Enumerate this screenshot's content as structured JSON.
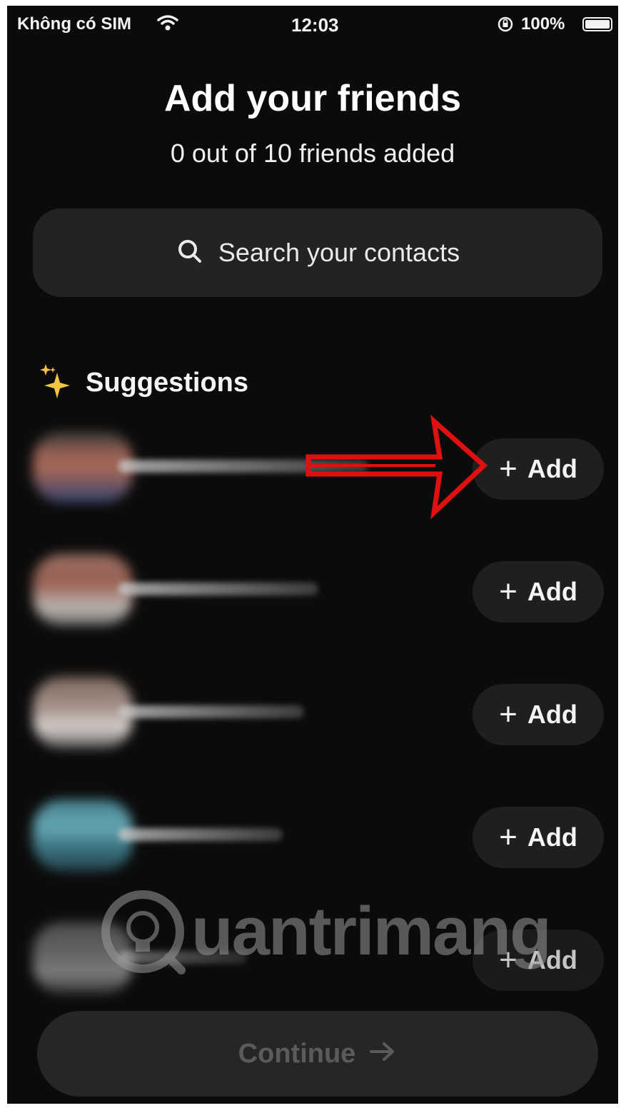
{
  "status_bar": {
    "carrier": "Không có SIM",
    "time": "12:03",
    "battery_percent": "100%",
    "icons": [
      "wifi-icon",
      "orientation-lock-icon",
      "battery-icon"
    ]
  },
  "header": {
    "title": "Add your friends",
    "subtitle": "0 out of 10 friends added"
  },
  "search": {
    "placeholder": "Search your contacts",
    "icon": "search-icon"
  },
  "suggestions": {
    "label": "Suggestions",
    "icon": "sparkles-icon",
    "items": [
      {
        "add_label": "Add",
        "avatar_color": "#b07060"
      },
      {
        "add_label": "Add",
        "avatar_color": "#a87a6e"
      },
      {
        "add_label": "Add",
        "avatar_color": "#b9a39a"
      },
      {
        "add_label": "Add",
        "avatar_color": "#5aa0b0"
      },
      {
        "add_label": "Add",
        "avatar_color": "#6e6e6e"
      }
    ]
  },
  "footer": {
    "continue_label": "Continue",
    "continue_icon": "arrow-right-icon"
  },
  "watermark": {
    "text": "uantrimang"
  },
  "colors": {
    "background": "#0b0b0b",
    "surface": "#232323",
    "annotation_arrow": "#e01010",
    "sparkle": "#f5c542"
  }
}
